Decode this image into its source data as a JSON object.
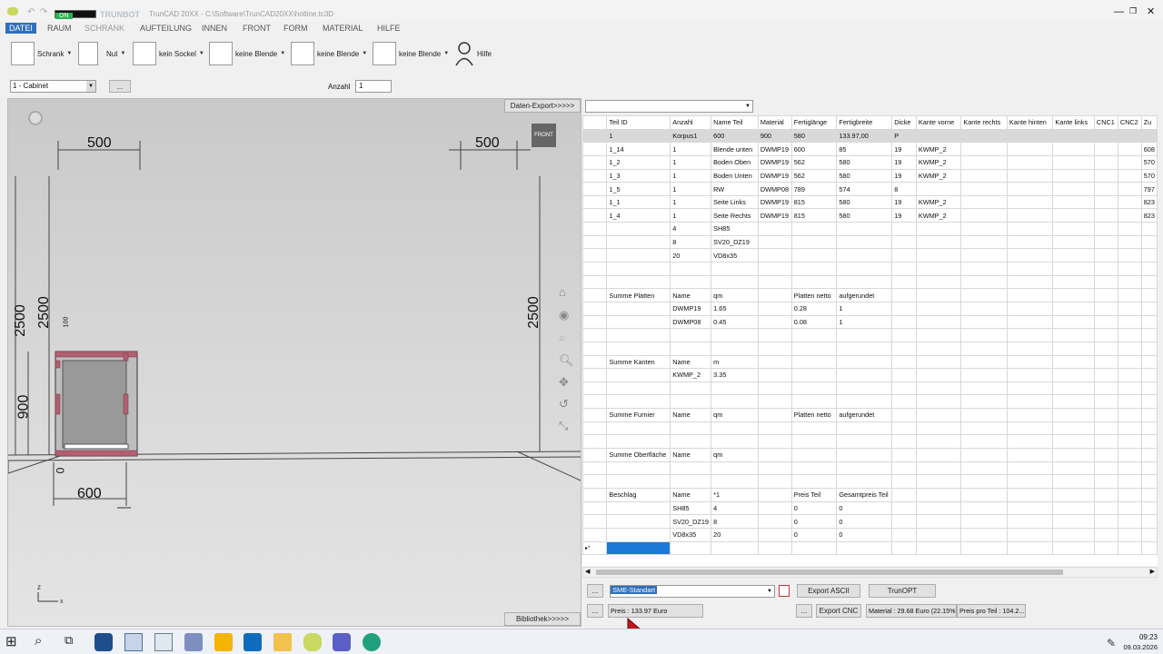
{
  "titlebar": {
    "on_label": "ON",
    "brand": "TRUNBOT",
    "title": "TrunCAD 20XX - C:\\Software\\TrunCAD20XX\\hotline.tc3D"
  },
  "menu": [
    "DATEI",
    "RAUM",
    "SCHRANK",
    "AUFTEILUNG",
    "INNEN",
    "FRONT",
    "FORM",
    "MATERIAL",
    "HILFE"
  ],
  "ribbon": {
    "schrank": "Schrank",
    "nut": "Nut",
    "sockel": "kein Sockel",
    "blende1": "keine Blende",
    "blende2": "keine Blende",
    "blende3": "keine Blende",
    "hilfe": "Hilfe"
  },
  "options": {
    "cabinet_select": "1 - Cabinet",
    "dots": "...",
    "anzahl_label": "Anzahl",
    "anzahl_value": "1"
  },
  "viewport": {
    "export_btn": "Daten-Export>>>>>",
    "library_btn": "Bibliothek>>>>>",
    "front_badge": "FRONT",
    "dims": {
      "top_left": "500",
      "top_right": "500",
      "left_outer": "2500",
      "left_inner": "2500",
      "left_900": "900",
      "right": "2500",
      "bottom": "600",
      "bottom0": "0",
      "small": "100"
    }
  },
  "table": {
    "headers": [
      "Teil ID",
      "Anzahl",
      "Name Teil",
      "Material",
      "Fertiglänge",
      "Fertigbreite",
      "Dicke",
      "Kante vorne",
      "Kante rechts",
      "Kante hinten",
      "Kante links",
      "CNC1",
      "CNC2",
      "Zu"
    ],
    "rows": [
      [
        "1",
        "Korpus1",
        "600",
        "900",
        "580",
        "133.97,00",
        "P",
        "",
        "",
        "",
        "",
        "",
        "",
        ""
      ],
      [
        "1_14",
        "1",
        "Blende unten",
        "DWMP19",
        "600",
        "85",
        "19",
        "KWMP_2",
        "",
        "",
        "",
        "",
        "",
        "608"
      ],
      [
        "1_2",
        "1",
        "Boden Oben",
        "DWMP19",
        "562",
        "580",
        "19",
        "KWMP_2",
        "",
        "",
        "",
        "",
        "",
        "570"
      ],
      [
        "1_3",
        "1",
        "Boden Unten",
        "DWMP19",
        "562",
        "580",
        "19",
        "KWMP_2",
        "",
        "",
        "",
        "",
        "",
        "570"
      ],
      [
        "1_5",
        "1",
        "RW",
        "DWMP08",
        "789",
        "574",
        "8",
        "",
        "",
        "",
        "",
        "",
        "",
        "797"
      ],
      [
        "1_1",
        "1",
        "Seite Links",
        "DWMP19",
        "815",
        "580",
        "19",
        "KWMP_2",
        "",
        "",
        "",
        "",
        "",
        "823"
      ],
      [
        "1_4",
        "1",
        "Seite Rechts",
        "DWMP19",
        "815",
        "580",
        "19",
        "KWMP_2",
        "",
        "",
        "",
        "",
        "",
        "823"
      ],
      [
        "",
        "4",
        "SH85",
        "",
        "",
        "",
        "",
        "",
        "",
        "",
        "",
        "",
        "",
        ""
      ],
      [
        "",
        "8",
        "SV20_DZ19",
        "",
        "",
        "",
        "",
        "",
        "",
        "",
        "",
        "",
        "",
        ""
      ],
      [
        "",
        "20",
        "VD8x35",
        "",
        "",
        "",
        "",
        "",
        "",
        "",
        "",
        "",
        "",
        ""
      ],
      [
        "",
        "",
        "",
        "",
        "",
        "",
        "",
        "",
        "",
        "",
        "",
        "",
        "",
        ""
      ],
      [
        "",
        "",
        "",
        "",
        "",
        "",
        "",
        "",
        "",
        "",
        "",
        "",
        "",
        ""
      ],
      [
        "Summe Platten",
        "Name",
        "qm",
        "",
        "Platten netto",
        "aufgerundet",
        "",
        "",
        "",
        "",
        "",
        "",
        "",
        ""
      ],
      [
        "",
        "DWMP19",
        "1.65",
        "",
        "0.28",
        "1",
        "",
        "",
        "",
        "",
        "",
        "",
        "",
        ""
      ],
      [
        "",
        "DWMP08",
        "0.45",
        "",
        "0.08",
        "1",
        "",
        "",
        "",
        "",
        "",
        "",
        "",
        ""
      ],
      [
        "",
        "",
        "",
        "",
        "",
        "",
        "",
        "",
        "",
        "",
        "",
        "",
        "",
        ""
      ],
      [
        "",
        "",
        "",
        "",
        "",
        "",
        "",
        "",
        "",
        "",
        "",
        "",
        "",
        ""
      ],
      [
        "Summe Kanten",
        "Name",
        "m",
        "",
        "",
        "",
        "",
        "",
        "",
        "",
        "",
        "",
        "",
        ""
      ],
      [
        "",
        "KWMP_2",
        "3.35",
        "",
        "",
        "",
        "",
        "",
        "",
        "",
        "",
        "",
        "",
        ""
      ],
      [
        "",
        "",
        "",
        "",
        "",
        "",
        "",
        "",
        "",
        "",
        "",
        "",
        "",
        ""
      ],
      [
        "",
        "",
        "",
        "",
        "",
        "",
        "",
        "",
        "",
        "",
        "",
        "",
        "",
        ""
      ],
      [
        "Summe Furnier",
        "Name",
        "qm",
        "",
        "Platten netto",
        "aufgerundet",
        "",
        "",
        "",
        "",
        "",
        "",
        "",
        ""
      ],
      [
        "",
        "",
        "",
        "",
        "",
        "",
        "",
        "",
        "",
        "",
        "",
        "",
        "",
        ""
      ],
      [
        "",
        "",
        "",
        "",
        "",
        "",
        "",
        "",
        "",
        "",
        "",
        "",
        "",
        ""
      ],
      [
        "Summe Oberfläche",
        "Name",
        "qm",
        "",
        "",
        "",
        "",
        "",
        "",
        "",
        "",
        "",
        "",
        ""
      ],
      [
        "",
        "",
        "",
        "",
        "",
        "",
        "",
        "",
        "",
        "",
        "",
        "",
        "",
        ""
      ],
      [
        "",
        "",
        "",
        "",
        "",
        "",
        "",
        "",
        "",
        "",
        "",
        "",
        "",
        ""
      ],
      [
        "Beschlag",
        "Name",
        "*1",
        "",
        "Preis Teil",
        "Gesamtpreis Teil",
        "",
        "",
        "",
        "",
        "",
        "",
        "",
        ""
      ],
      [
        "",
        "SH85",
        "4",
        "",
        "0",
        "0",
        "",
        "",
        "",
        "",
        "",
        "",
        "",
        ""
      ],
      [
        "",
        "SV20_DZ19",
        "8",
        "",
        "0",
        "0",
        "",
        "",
        "",
        "",
        "",
        "",
        "",
        ""
      ],
      [
        "",
        "VD8x35",
        "20",
        "",
        "0",
        "0",
        "",
        "",
        "",
        "",
        "",
        "",
        "",
        ""
      ]
    ],
    "new_row_marker": "▸*"
  },
  "bottom": {
    "dots": "...",
    "preset": "SME-Standart",
    "export_ascii": "Export ASCII",
    "trunopt": "TrunOPT",
    "preis": "Preis : 133.97 Euro",
    "export_cnc": "Export CNC",
    "material": "Material : 29.68 Euro (22.15%)",
    "preis_teil": "Preis pro Teil : 104.2..."
  },
  "taskbar": {
    "time": "09:23",
    "date": "09.03.2026"
  },
  "colors": {
    "accent": "#2f6fbd",
    "selected_cell": "#1e78d7",
    "cabinet_edge": "#b06070"
  }
}
